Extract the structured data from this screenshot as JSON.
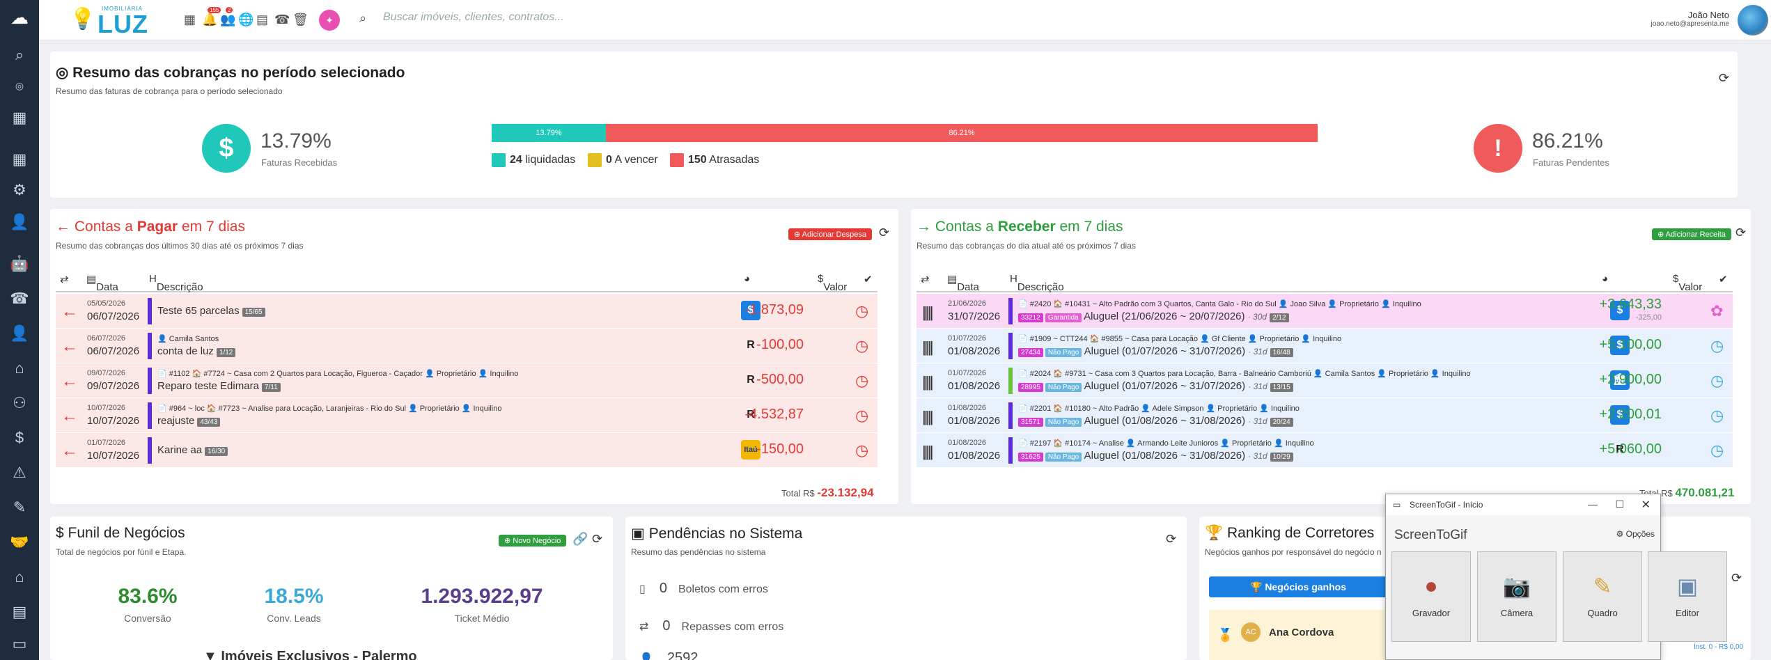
{
  "topbar": {
    "logo_small": "IMOBILIÁRIA",
    "logo_big": "LUZ",
    "badge1": "155",
    "badge2": "2",
    "search_placeholder": "Buscar imóveis, clientes, contratos...",
    "user_name": "João Neto",
    "user_email": "joao.neto@apresenta.me"
  },
  "summary": {
    "title": "Resumo das cobranças no período selecionado",
    "subtitle": "Resumo das faturas de cobrança para o período selecionado",
    "received_pct": "13.79%",
    "received_label": "Faturas Recebidas",
    "pending_pct": "86.21%",
    "pending_label": "Faturas Pendentes",
    "bar_green": "13.79%",
    "bar_red": "86.21%",
    "paid_fraction": 0.1379,
    "legend": [
      {
        "count": "24",
        "label": "liquidadas",
        "color": "#1fc8b8"
      },
      {
        "count": "0",
        "label": "A vencer",
        "color": "#e2c01e"
      },
      {
        "count": "150",
        "label": "Atrasadas",
        "color": "#f05a5a"
      }
    ]
  },
  "pay": {
    "title_a": "Contas a ",
    "title_b": "Pagar",
    "title_c": " em 7 dias",
    "subtitle": "Resumo das cobranças dos últimos 30 dias até os próximos 7 dias",
    "add": "Adicionar Despesa",
    "col_date": "Data",
    "col_desc": "Descrição",
    "col_value": "Valor",
    "total_label": "Total R$",
    "total": "-23.132,94",
    "rows": [
      {
        "d1": "05/05/2026",
        "d2": "06/07/2026",
        "meta": "",
        "desc": "Teste 65 parcelas",
        "tag": "15/65",
        "value": "-1.873,09",
        "bank": "$"
      },
      {
        "d1": "06/07/2026",
        "d2": "06/07/2026",
        "meta": "👤 Camila Santos",
        "desc": "conta de luz",
        "tag": "1/12",
        "value": "-100,00",
        "bank": "R"
      },
      {
        "d1": "09/07/2026",
        "d2": "09/07/2026",
        "meta": "📄 #1102  🏠 #7724 ~ Casa com 2 Quartos para Locação, Figueroa - Caçador 👤 Proprietário 👤 Inquilino",
        "desc": "Reparo teste Edimara",
        "tag": "7/11",
        "value": "-500,00",
        "bank": "R"
      },
      {
        "d1": "10/07/2026",
        "d2": "10/07/2026",
        "meta": "📄 #964 ~ loc 🏠 #7723 ~ Analise para Locação, Laranjeiras - Rio do Sul 👤 Proprietário 👤 Inquilino",
        "desc": "reajuste",
        "tag": "43/43",
        "value": "-4.532,87",
        "bank": "R"
      },
      {
        "d1": "01/07/2026",
        "d2": "10/07/2026",
        "meta": "",
        "desc": "Karine aa",
        "tag": "16/30",
        "value": "-150,00",
        "bank": "Itaú"
      }
    ]
  },
  "recv": {
    "title_a": "Contas a ",
    "title_b": "Receber",
    "title_c": " em 7 dias",
    "subtitle": "Resumo das cobranças do dia atual até os próximos 7 dias",
    "add": "Adicionar Receita",
    "col_date": "Data",
    "col_desc": "Descrição",
    "col_value": "Valor",
    "total_label": "Total R$",
    "total": "470.081,21",
    "rows": [
      {
        "d1": "21/06/2026",
        "d2": "31/07/2026",
        "meta": "📄 #2420  🏠 #10431 ~ Alto Padrão com 3 Quartos, Canta Galo - Rio do Sul 👤 Joao Silva 👤 Proprietário 👤 Inquilino",
        "code": "33212",
        "status": "Garantida",
        "desc": "Aluguel (21/06/2026 ~ 20/07/2026)",
        "days": "· 30d",
        "tag": "2/12",
        "value": "+3.643,33",
        "sub": "-325,00",
        "bank": "$"
      },
      {
        "d1": "01/07/2026",
        "d2": "01/08/2026",
        "meta": "📄 #1909 ~ CTT244 🏠 #9855 ~ Casa para Locação 👤 Gf Cliente 👤 Proprietário 👤 Inquilino",
        "code": "27434",
        "status": "Não Pago",
        "desc": "Aluguel (01/07/2026 ~ 31/07/2026)",
        "days": "· 31d",
        "tag": "16/48",
        "value": "+5.100,00",
        "sub": "",
        "bank": "$"
      },
      {
        "d1": "01/07/2026",
        "d2": "01/08/2026",
        "meta": "📄 #2024  🏠 #9731 ~ Casa com 3 Quartos para Locação, Barra - Balneário Camboriú 👤 Camila Santos 👤 Proprietário 👤 Inquilino",
        "code": "28995",
        "status": "Não Pago",
        "desc": "Aluguel (01/07/2026 ~ 31/07/2026)",
        "days": "· 31d",
        "tag": "13/15",
        "value": "+2.900,00",
        "sub": "",
        "bank": "🏛"
      },
      {
        "d1": "01/08/2026",
        "d2": "01/08/2026",
        "meta": "📄 #2201  🏠 #10180 ~ Alto Padrão 👤 Adele Simpson 👤 Proprietário 👤 Inquilino",
        "code": "31571",
        "status": "Não Pago",
        "desc": "Aluguel (01/08/2026 ~ 31/08/2026)",
        "days": "· 31d",
        "tag": "20/24",
        "value": "+2.200,01",
        "sub": "",
        "bank": "$"
      },
      {
        "d1": "01/08/2026",
        "d2": "01/08/2026",
        "meta": "📄 #2197  🏠 #10174 ~ Analise 👤 Armando Leite Junioros 👤 Proprietário 👤 Inquilino",
        "code": "31625",
        "status": "Não Pago",
        "desc": "Aluguel (01/08/2026 ~ 31/08/2026)",
        "days": "· 31d",
        "tag": "10/29",
        "value": "+5.060,00",
        "sub": "",
        "bank": "R"
      }
    ]
  },
  "funnel": {
    "title": "Funil de Negócios",
    "subtitle": "Total de negócios por fúnil e Etapa.",
    "add": "Novo Negócio",
    "conv": "83.6%",
    "conv_label": "Conversão",
    "leads": "18.5%",
    "leads_label": "Conv. Leads",
    "ticket": "1.293.922,97",
    "ticket_label": "Ticket Médio",
    "bottom": "Imóveis Exclusivos - Palermo"
  },
  "pend": {
    "title": "Pendências no Sistema",
    "subtitle": "Resumo das pendências no sistema",
    "items": [
      {
        "num": "0",
        "label": "Boletos com erros"
      },
      {
        "num": "0",
        "label": "Repasses com erros"
      },
      {
        "num": "2592",
        "label": ""
      }
    ]
  },
  "rank": {
    "title": "Ranking de Corretores",
    "subtitle": "Negócios ganhos por responsável do negócio n",
    "button": "Negócios ganhos",
    "person": "Ana Cordova",
    "initials": "AC",
    "foot": "Ínst. 0 - R$ 0,00"
  },
  "stg": {
    "title": "ScreenToGif - Início",
    "heading": "ScreenToGif",
    "options": "Opções",
    "tiles": [
      "Gravador",
      "Câmera",
      "Quadro",
      "Editor"
    ]
  }
}
